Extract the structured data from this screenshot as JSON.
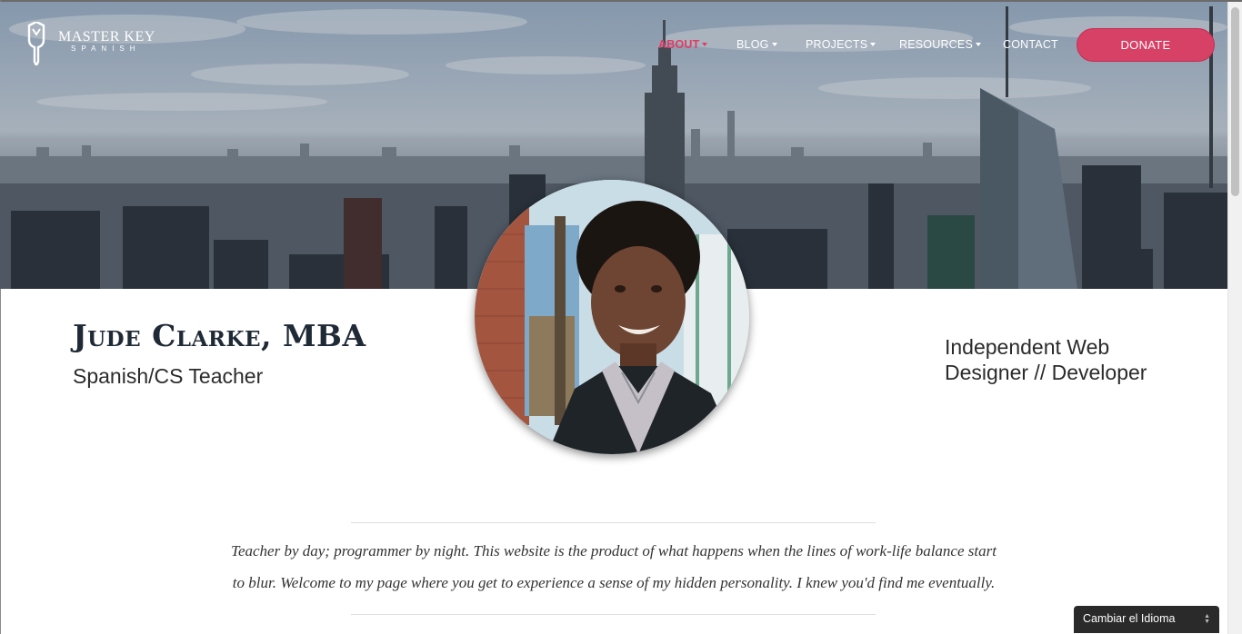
{
  "logo": {
    "title": "MASTER KEY",
    "subtitle": "SPANISH"
  },
  "nav": {
    "items": [
      {
        "label": "ABOUT",
        "dropdown": true,
        "active": true
      },
      {
        "label": "BLOG",
        "dropdown": true,
        "active": false
      },
      {
        "label": "PROJECTS",
        "dropdown": true,
        "active": false
      },
      {
        "label": "RESOURCES",
        "dropdown": true,
        "active": false
      },
      {
        "label": "CONTACT",
        "dropdown": false,
        "active": false
      }
    ],
    "donate_label": "DONATE"
  },
  "profile": {
    "name": "Jude Clarke, MBA",
    "title_left": "Spanish/CS Teacher",
    "title_right": "Independent Web Designer // Developer"
  },
  "intro": {
    "line1": "Teacher by day; programmer by night. This website is the product of what happens when the lines of work-life balance start",
    "line2": "to blur. Welcome to my page where you get to experience a sense of my hidden personality. I knew you'd find me eventually."
  },
  "language_select": {
    "label": "Cambiar el Idioma"
  },
  "colors": {
    "accent": "#e23b62",
    "donate_bg": "#d64165",
    "heading": "#1f2a36"
  },
  "icons": {
    "logo": "master-key-logo-icon",
    "avatar": "profile-photo"
  }
}
